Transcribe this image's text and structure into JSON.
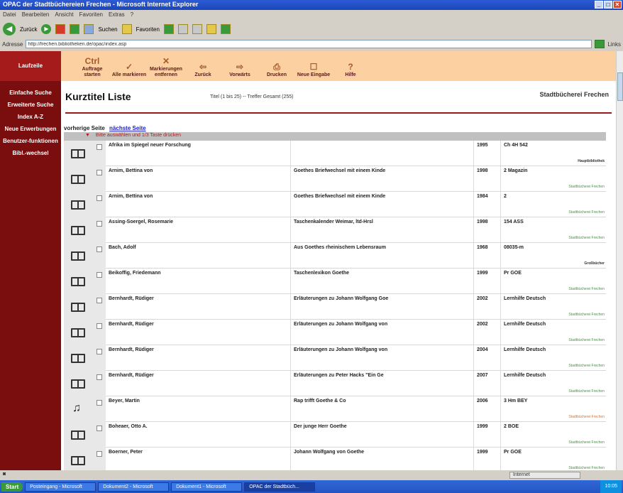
{
  "window": {
    "title": "OPAC der Stadtbüchereien Frechen - Microsoft Internet Explorer"
  },
  "menubar": [
    "Datei",
    "Bearbeiten",
    "Ansicht",
    "Favoriten",
    "Extras",
    "?"
  ],
  "toolbar": {
    "back": "Zurück",
    "search": "Suchen",
    "favorites": "Favoriten"
  },
  "address": {
    "label": "Adresse",
    "value": "http://frechen.bibliotheken.de/opac/index.asp",
    "links": "Links"
  },
  "sidebar": {
    "items": [
      "Laufzeile",
      "Einfache Suche",
      "Erweiterte Suche",
      "Index A-Z",
      "Neue Erwerbungen",
      "Benutzer-funktionen",
      "Bibl.-wechsel"
    ]
  },
  "appbar": {
    "buttons": [
      {
        "icon": "Ctrl",
        "label": "Auftrage starten"
      },
      {
        "icon": "✓",
        "label": "Alle markieren"
      },
      {
        "icon": "✕",
        "label": "Markierungen entfernen"
      },
      {
        "icon": "⇦",
        "label": "Zurück"
      },
      {
        "icon": "⇨",
        "label": "Vorwärts"
      },
      {
        "icon": "⎙",
        "label": "Drucken"
      },
      {
        "icon": "☐",
        "label": "Neue Eingabe"
      },
      {
        "icon": "?",
        "label": "Hilfe"
      }
    ]
  },
  "header": {
    "title": "Kurztitel Liste",
    "hits": "Titel (1 bis 25) -- Treffer Gesamt (255)",
    "library": "Stadtbücherei Frechen"
  },
  "pager": {
    "prev": "vorherige Seite",
    "next": "nächste Seite"
  },
  "selection_bar": "Bitte auswählen und 1/3 Taste drücken",
  "rows": [
    {
      "media": "book",
      "author": "Afrika im Spiegel neuer Forschung",
      "title": "",
      "year": "1995",
      "sig": "Ch 4H 542",
      "lib": "Hauptbibliothek",
      "lib_style": "d"
    },
    {
      "media": "book",
      "author": "Arnim, Bettina von",
      "title": "Goethes Briefwechsel mit einem Kinde",
      "year": "1998",
      "sig": "2 Magazin",
      "lib": "Stadtbücherei Frechen",
      "lib_style": ""
    },
    {
      "media": "book",
      "author": "Arnim, Bettina von",
      "title": "Goethes Briefwechsel mit einem Kinde",
      "year": "1984",
      "sig": "2",
      "lib": "Stadtbücherei Frechen",
      "lib_style": ""
    },
    {
      "media": "book",
      "author": "Assing-Soergel, Rosemarie",
      "title": "Taschenkalender Weimar, ltd-Hrsl",
      "year": "1998",
      "sig": "154 ASS",
      "lib": "Stadtbücherei Frechen",
      "lib_style": ""
    },
    {
      "media": "book",
      "author": "Bach, Adolf",
      "title": "Aus Goethes rheinischem Lebensraum",
      "year": "1968",
      "sig": "08035-m",
      "lib": "Großbücher",
      "lib_style": "d"
    },
    {
      "media": "book",
      "author": "Beikoffig, Friedemann",
      "title": "Taschenlexikon Goethe",
      "year": "1999",
      "sig": "Pr GOE",
      "lib": "Stadtbücherei Frechen",
      "lib_style": ""
    },
    {
      "media": "book",
      "author": "Bernhardt, Rüdiger",
      "title": "Erläuterungen zu Johann Wolfgang Goe",
      "year": "2002",
      "sig": "Lernhilfe Deutsch",
      "lib": "Stadtbücherei Frechen",
      "lib_style": ""
    },
    {
      "media": "book",
      "author": "Bernhardt, Rüdiger",
      "title": "Erläuterungen zu Johann Wolfgang von",
      "year": "2002",
      "sig": "Lernhilfe Deutsch",
      "lib": "Stadtbücherei Frechen",
      "lib_style": ""
    },
    {
      "media": "book",
      "author": "Bernhardt, Rüdiger",
      "title": "Erläuterungen zu Johann Wolfgang von",
      "year": "2004",
      "sig": "Lernhilfe Deutsch",
      "lib": "Stadtbücherei Frechen",
      "lib_style": ""
    },
    {
      "media": "book",
      "author": "Bernhardt, Rüdiger",
      "title": "Erläuterungen zu Peter Hacks \"Ein Ge",
      "year": "2007",
      "sig": "Lernhilfe Deutsch",
      "lib": "Stadtbücherei Frechen",
      "lib_style": ""
    },
    {
      "media": "audio",
      "author": "Beyer, Martin",
      "title": "Rap trifft Goethe & Co",
      "year": "2006",
      "sig": "3 Hm BEY",
      "lib": "Stadtbücherei Frechen",
      "lib_style": "o"
    },
    {
      "media": "book",
      "author": "Boheaer, Otto A.",
      "title": "Der junge Herr Goethe",
      "year": "1999",
      "sig": "2 BOE",
      "lib": "Stadtbücherei Frechen",
      "lib_style": ""
    },
    {
      "media": "book",
      "author": "Boerner, Peter",
      "title": "Johann Wolfgang von Goethe",
      "year": "1999",
      "sig": "Pr GOE",
      "lib": "Stadtbücherei Frechen",
      "lib_style": ""
    }
  ],
  "statusbar": {
    "zone": "Internet"
  },
  "taskbar": {
    "start": "Start",
    "tasks": [
      "Posteingang - Microsoft",
      "Dokument2 - Microsoft",
      "Dokument1 - Microsoft",
      "OPAC der Stadtbüch..."
    ],
    "clock": "10:05"
  }
}
